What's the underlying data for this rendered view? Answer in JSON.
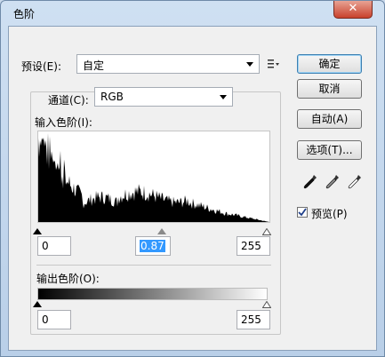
{
  "window": {
    "title": "色阶",
    "close_glyph": "✕"
  },
  "preset": {
    "label": "预设(E):",
    "value": "自定",
    "menu_icon": "list-menu-icon"
  },
  "channel": {
    "label": "通道(C):",
    "value": "RGB"
  },
  "input_levels": {
    "label": "输入色阶(I):",
    "black": "0",
    "gamma": "0.87",
    "white": "255"
  },
  "output_levels": {
    "label": "输出色阶(O):",
    "black": "0",
    "white": "255"
  },
  "buttons": {
    "ok": "确定",
    "cancel": "取消",
    "auto": "自动(A)",
    "options": "选项(T)..."
  },
  "eyedroppers": [
    "black-eyedropper-icon",
    "gray-eyedropper-icon",
    "white-eyedropper-icon"
  ],
  "preview": {
    "label": "预览(P)",
    "checked": true
  },
  "colors": {
    "selection": "#3399ff",
    "close_red": "#c8412c"
  }
}
